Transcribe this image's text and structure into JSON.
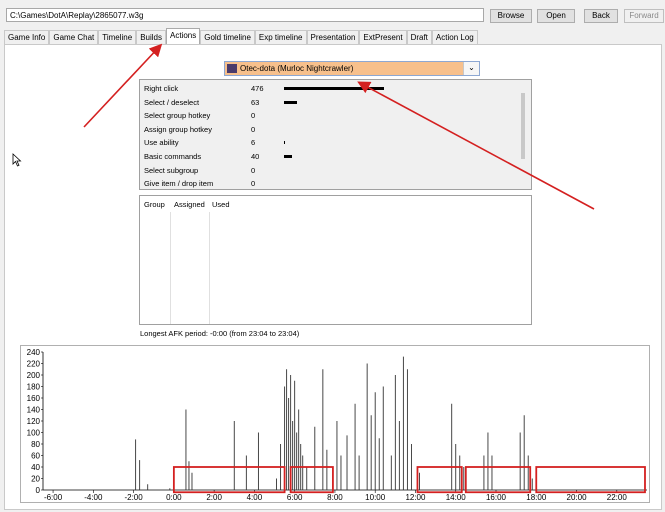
{
  "toolbar": {
    "path_value": "C:\\Games\\DotA\\Replay\\2865077.w3g",
    "browse_label": "Browse",
    "open_label": "Open",
    "back_label": "Back",
    "forward_label": "Forward"
  },
  "tabs": [
    {
      "label": "Game Info"
    },
    {
      "label": "Game Chat"
    },
    {
      "label": "Timeline"
    },
    {
      "label": "Builds"
    },
    {
      "label": "Actions",
      "active": true
    },
    {
      "label": "Gold timeline"
    },
    {
      "label": "Exp timeline"
    },
    {
      "label": "Presentation"
    },
    {
      "label": "ExtPresent"
    },
    {
      "label": "Draft"
    },
    {
      "label": "Action Log"
    }
  ],
  "player_select": {
    "value": "Otec-dota (Murloc Nightcrawler)",
    "highlight_color": "#f7c08c",
    "icon": "hero-portrait-icon"
  },
  "actions": [
    {
      "label": "Right click",
      "value": "476"
    },
    {
      "label": "Select / deselect",
      "value": "63"
    },
    {
      "label": "Select group hotkey",
      "value": "0"
    },
    {
      "label": "Assign group hotkey",
      "value": "0"
    },
    {
      "label": "Use ability",
      "value": "6"
    },
    {
      "label": "Basic commands",
      "value": "40"
    },
    {
      "label": "Select subgroup",
      "value": "0"
    },
    {
      "label": "Give item / drop item",
      "value": "0"
    }
  ],
  "groups": {
    "headers": [
      "Group",
      "Assigned",
      "Used"
    ]
  },
  "afk_text": "Longest AFK period: -0:00 (from 23:04 to 23:04)",
  "annotation_color": "#d42020",
  "chart_data": {
    "type": "bar",
    "y_ticks": [
      "240",
      "220",
      "200",
      "180",
      "160",
      "140",
      "120",
      "100",
      "80",
      "60",
      "40",
      "20",
      "0"
    ],
    "x_ticks": [
      "-6:00",
      "-4:00",
      "-2:00",
      "0:00",
      "2:00",
      "4:00",
      "6:00",
      "8:00",
      "10:00",
      "12:00",
      "14:00",
      "16:00",
      "18:00",
      "20:00",
      "22:00"
    ],
    "ylim": [
      0,
      240
    ],
    "xlim": [
      -6.5,
      23.5
    ],
    "x_unit": "minutes",
    "bars": [
      [
        -1.9,
        88
      ],
      [
        -1.7,
        52
      ],
      [
        -1.3,
        10
      ],
      [
        -0.2,
        3
      ],
      [
        0.6,
        140
      ],
      [
        0.75,
        50
      ],
      [
        0.9,
        30
      ],
      [
        3.0,
        120
      ],
      [
        3.6,
        60
      ],
      [
        4.2,
        100
      ],
      [
        5.1,
        20
      ],
      [
        5.3,
        80
      ],
      [
        5.5,
        180
      ],
      [
        5.6,
        210
      ],
      [
        5.7,
        160
      ],
      [
        5.8,
        200
      ],
      [
        5.9,
        120
      ],
      [
        6.0,
        190
      ],
      [
        6.1,
        100
      ],
      [
        6.2,
        140
      ],
      [
        6.3,
        80
      ],
      [
        6.4,
        60
      ],
      [
        6.6,
        40
      ],
      [
        7.0,
        110
      ],
      [
        7.4,
        210
      ],
      [
        7.6,
        70
      ],
      [
        8.1,
        120
      ],
      [
        8.3,
        60
      ],
      [
        8.6,
        95
      ],
      [
        9.0,
        150
      ],
      [
        9.2,
        60
      ],
      [
        9.6,
        220
      ],
      [
        9.8,
        130
      ],
      [
        10.0,
        170
      ],
      [
        10.2,
        90
      ],
      [
        10.4,
        180
      ],
      [
        10.8,
        60
      ],
      [
        11.0,
        200
      ],
      [
        11.2,
        120
      ],
      [
        11.4,
        232
      ],
      [
        11.6,
        210
      ],
      [
        11.8,
        80
      ],
      [
        12.2,
        30
      ],
      [
        13.8,
        150
      ],
      [
        14.0,
        80
      ],
      [
        14.2,
        60
      ],
      [
        14.4,
        40
      ],
      [
        15.4,
        60
      ],
      [
        15.6,
        100
      ],
      [
        15.8,
        60
      ],
      [
        17.2,
        100
      ],
      [
        17.4,
        130
      ],
      [
        17.6,
        60
      ],
      [
        17.8,
        20
      ]
    ]
  }
}
